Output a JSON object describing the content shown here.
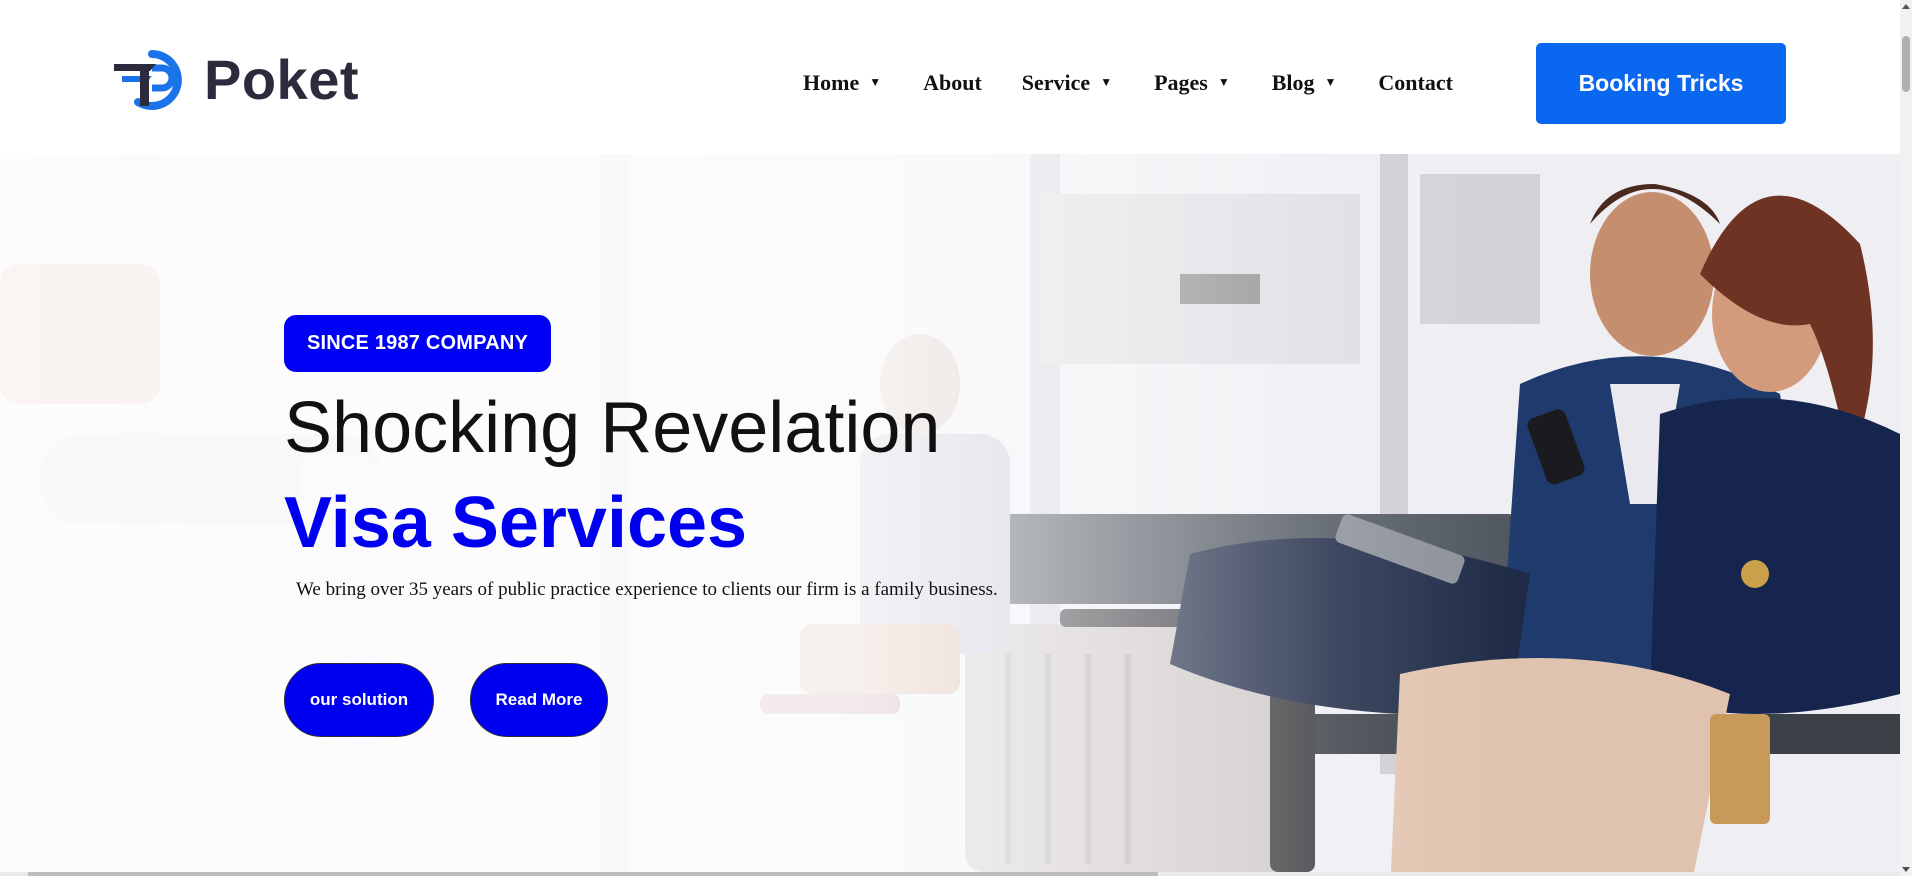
{
  "brand": {
    "name": "Poket",
    "logo_icon": "poket-p-wing-logo",
    "colors": {
      "logo_primary": "#1a73e8",
      "logo_text": "#2b2b3d"
    }
  },
  "nav": {
    "items": [
      {
        "label": "Home",
        "dropdown": true
      },
      {
        "label": "About",
        "dropdown": false
      },
      {
        "label": "Service",
        "dropdown": true
      },
      {
        "label": "Pages",
        "dropdown": true
      },
      {
        "label": "Blog",
        "dropdown": true
      },
      {
        "label": "Contact",
        "dropdown": false
      }
    ],
    "dropdown_icon": "caret-down-icon",
    "cta_label": "Booking Tricks",
    "cta_color": "#0a67ef"
  },
  "hero": {
    "badge": "SINCE 1987 COMPANY",
    "title": "Shocking Revelation",
    "subtitle": "Visa Services",
    "description": "We bring over 35 years of public practice experience to clients our firm is a family business.",
    "buttons": [
      "our solution",
      "Read More"
    ],
    "accent_color": "#0000f0",
    "background_image": "couple-at-airport-with-phone-and-luggage"
  }
}
